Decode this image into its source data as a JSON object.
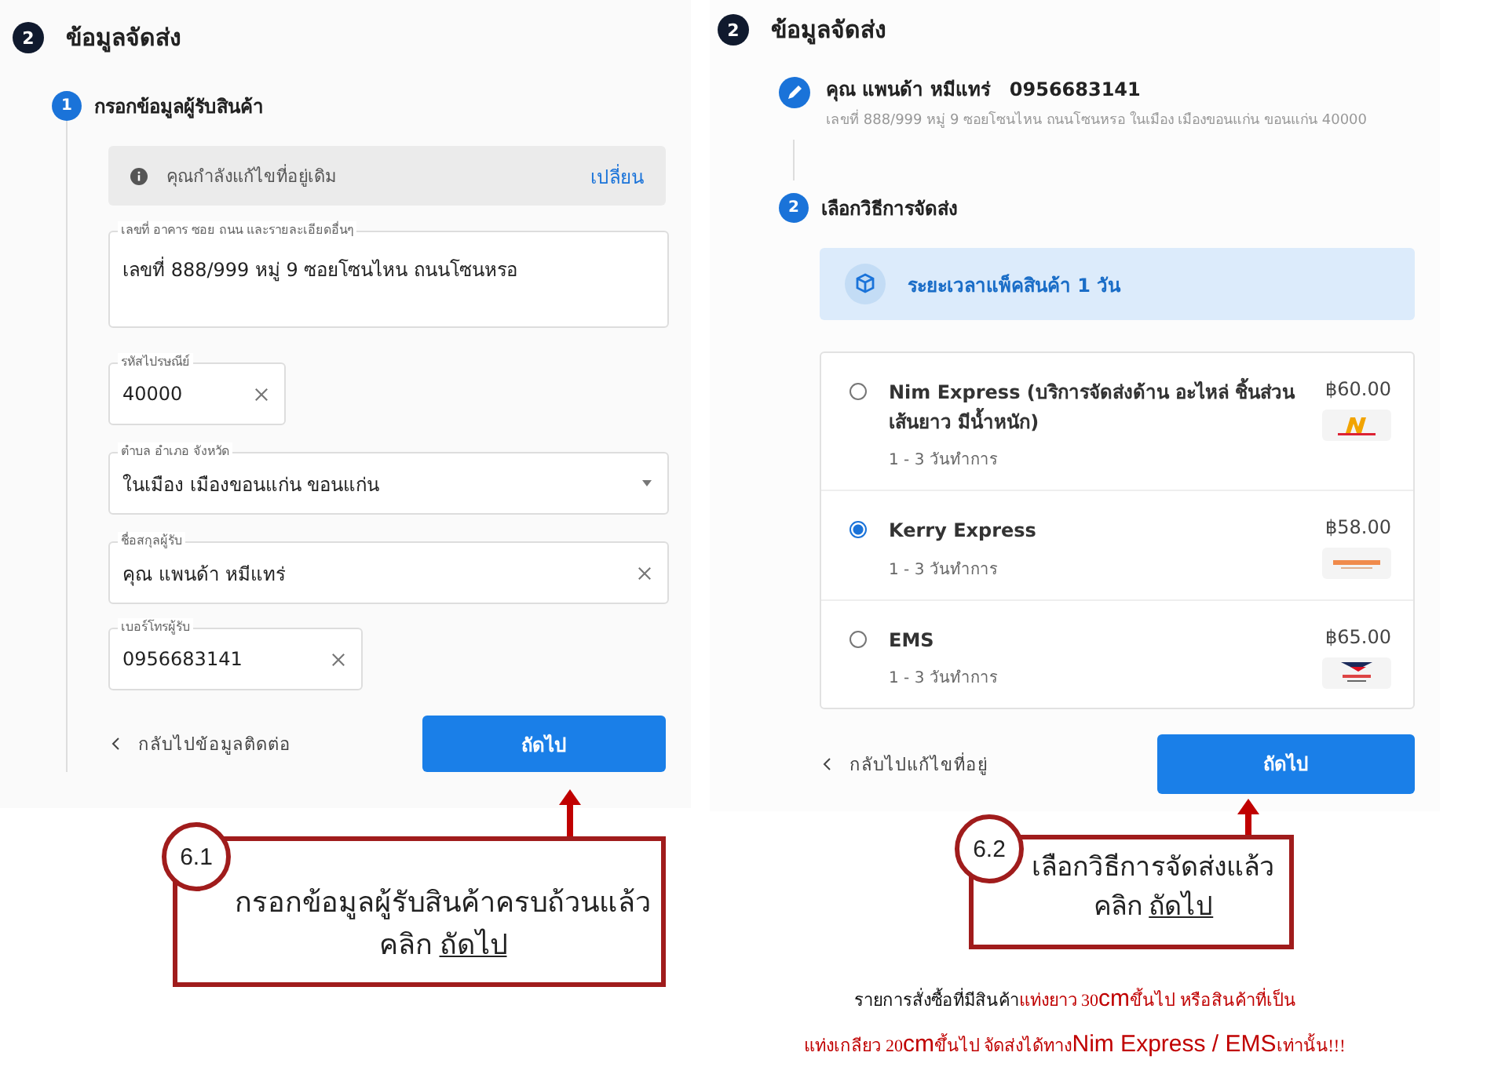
{
  "left": {
    "section_number": "2",
    "section_title": "ข้อมูลจัดส่ง",
    "step_number": "1",
    "step_title": "กรอกข้อมูลผู้รับสินค้า",
    "notice": {
      "text": "คุณกำลังแก้ไขที่อยู่เดิม",
      "action": "เปลี่ยน"
    },
    "fields": [
      {
        "kind": "textarea",
        "label": "เลขที่ อาคาร ซอย ถนน และรายละเอียดอื่นๆ",
        "value": "เลขที่ 888/999 หมู่ 9 ซอยโซนไหน ถนนโซนหรอ"
      },
      {
        "kind": "short-clearable",
        "label": "รหัสไปรษณีย์",
        "value": "40000"
      },
      {
        "kind": "select",
        "label": "ตำบล อำเภอ จังหวัด",
        "value": "ในเมือง เมืองขอนแก่น ขอนแก่น"
      },
      {
        "kind": "clearable",
        "label": "ชื่อสกุลผู้รับ",
        "value": "คุณ แพนด้า หมีแทร่"
      },
      {
        "kind": "medium-clearable",
        "label": "เบอร์โทรผู้รับ",
        "value": "0956683141"
      }
    ],
    "back_link": "กลับไปข้อมูลติดต่อ",
    "next_button": "ถัดไป",
    "callout": {
      "badge": "6.1",
      "instruction": "กรอกข้อมูลผู้รับสินค้าครบถ้วนแล้ว",
      "action_prefix": "คลิก",
      "action": "ถัดไป"
    }
  },
  "right": {
    "section_number": "2",
    "section_title": "ข้อมูลจัดส่ง",
    "recipient": {
      "name": "คุณ แพนด้า หมีแทร่",
      "phone": "0956683141",
      "address": "เลขที่ 888/999 หมู่ 9 ซอยโซนไหน ถนนโซนหรอ ในเมือง เมืองขอนแก่น ขอนแก่น 40000"
    },
    "step_number": "2",
    "step_title": "เลือกวิธีการจัดส่ง",
    "packing_notice": "ระยะเวลาแพ็คสินค้า 1 วัน",
    "options": [
      {
        "name": "Nim Express (บริการจัดส่งด้าน อะไหล่ ชิ้นส่วนเส้นยาว มีน้ำหนัก)",
        "eta": "1 - 3 วันทำการ",
        "price": "฿60.00",
        "selected": false,
        "kind": "nim"
      },
      {
        "name": "Kerry Express",
        "eta": "1 - 3 วันทำการ",
        "price": "฿58.00",
        "selected": true,
        "kind": "kerry"
      },
      {
        "name": "EMS",
        "eta": "1 - 3 วันทำการ",
        "price": "฿65.00",
        "selected": false,
        "kind": "ems"
      }
    ],
    "back_link": "กลับไปแก้ไขที่อยู่",
    "next_button": "ถัดไป",
    "callout": {
      "badge": "6.2",
      "instruction": "เลือกวิธีการจัดส่งแล้ว",
      "action_prefix": "คลิก",
      "action": "ถัดไป"
    },
    "note_lines": [
      [
        {
          "kind": "plain",
          "text": "รายการสั่งซื้อที่มีสินค้า"
        },
        {
          "kind": "warning",
          "text": "แท่งยาว 30"
        },
        {
          "kind": "warning-large",
          "text": "cm"
        },
        {
          "kind": "warning",
          "text": "ขึ้นไป หรือสินค้าที่เป็น"
        }
      ],
      [
        {
          "kind": "warning",
          "text": "แท่งเกลียว  20"
        },
        {
          "kind": "warning-large",
          "text": "cm"
        },
        {
          "kind": "warning",
          "text": "ขึ้นไป จัดส่งได้ทาง"
        },
        {
          "kind": "warning-large",
          "text": "Nim Express / EMS"
        },
        {
          "kind": "warning",
          "text": "เท่านั้น!!!"
        }
      ]
    ]
  }
}
